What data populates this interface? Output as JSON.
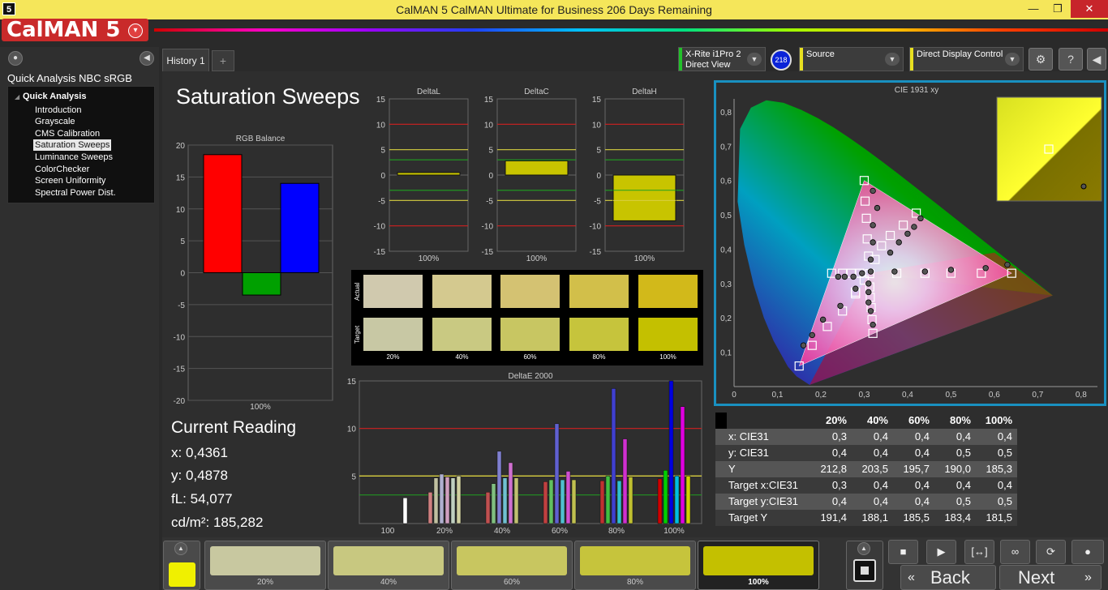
{
  "window": {
    "title": "CalMAN 5 CalMAN Ultimate for Business 206 Days Remaining",
    "app_icon": "5",
    "minimize": "—",
    "restore": "❐",
    "close": "✕"
  },
  "logo": {
    "text": "CalMAN 5"
  },
  "sidebar": {
    "workflow_title": "Quick Analysis NBC sRGB",
    "root": "Quick Analysis",
    "items": [
      {
        "label": "Introduction"
      },
      {
        "label": "Grayscale"
      },
      {
        "label": "CMS Calibration"
      },
      {
        "label": "Saturation Sweeps",
        "selected": true
      },
      {
        "label": "Luminance Sweeps"
      },
      {
        "label": "ColorChecker"
      },
      {
        "label": "Screen Uniformity"
      },
      {
        "label": "Spectral Power Dist."
      }
    ]
  },
  "tabs": {
    "history": "History 1",
    "add": "+"
  },
  "devices": {
    "meter": {
      "line1": "X-Rite i1Pro 2",
      "line2": "Direct View",
      "badge": "218",
      "color": "#22c02a"
    },
    "source": {
      "label": "Source",
      "color": "#e8e020"
    },
    "display": {
      "label": "Direct Display Control",
      "color": "#e8e020"
    }
  },
  "page": {
    "title": "Saturation Sweeps"
  },
  "rgb_balance": {
    "title": "RGB Balance",
    "xlabel": "100%"
  },
  "delta_l": {
    "title": "DeltaL",
    "xlabel": "100%"
  },
  "delta_c": {
    "title": "DeltaC",
    "xlabel": "100%"
  },
  "delta_h": {
    "title": "DeltaH",
    "xlabel": "100%"
  },
  "swatches": {
    "actual_label": "Actual",
    "target_label": "Target",
    "labels": [
      "20%",
      "40%",
      "60%",
      "80%",
      "100%"
    ],
    "actual": [
      "#d0c9ae",
      "#d4c98f",
      "#d4c272",
      "#d2bf4a",
      "#d2b91a"
    ],
    "target": [
      "#c8c8a4",
      "#c9c982",
      "#c8c662",
      "#c6c43c",
      "#c4c000"
    ]
  },
  "deltae": {
    "title": "DeltaE 2000"
  },
  "current_reading": {
    "title": "Current Reading",
    "x": "x: 0,4361",
    "y": "y: 0,4878",
    "fl": "fL: 54,077",
    "cdm2": "cd/m²: 185,282"
  },
  "cie": {
    "title": "CIE 1931 xy"
  },
  "table": {
    "headers": [
      "20%",
      "40%",
      "60%",
      "80%",
      "100%"
    ],
    "rows": [
      {
        "label": "x: CIE31",
        "values": [
          "0,3",
          "0,4",
          "0,4",
          "0,4",
          "0,4"
        ]
      },
      {
        "label": "y: CIE31",
        "values": [
          "0,4",
          "0,4",
          "0,4",
          "0,5",
          "0,5"
        ]
      },
      {
        "label": "Y",
        "values": [
          "212,8",
          "203,5",
          "195,7",
          "190,0",
          "185,3"
        ]
      },
      {
        "label": "Target x:CIE31",
        "values": [
          "0,3",
          "0,4",
          "0,4",
          "0,4",
          "0,4"
        ]
      },
      {
        "label": "Target y:CIE31",
        "values": [
          "0,4",
          "0,4",
          "0,4",
          "0,5",
          "0,5"
        ]
      },
      {
        "label": "Target Y",
        "values": [
          "191,4",
          "188,1",
          "185,5",
          "183,4",
          "181,5"
        ]
      }
    ]
  },
  "pages": [
    {
      "label": "",
      "color": "#f0f000"
    },
    {
      "label": "20%",
      "color": "#c8c8a0"
    },
    {
      "label": "40%",
      "color": "#c8c880"
    },
    {
      "label": "60%",
      "color": "#c8c660"
    },
    {
      "label": "80%",
      "color": "#c6c43c"
    },
    {
      "label": "100%",
      "color": "#c4c000"
    }
  ],
  "nav": {
    "back": "Back",
    "next": "Next"
  },
  "chart_data": [
    {
      "type": "bar",
      "title": "RGB Balance",
      "categories": [
        "100%"
      ],
      "series": [],
      "values": [
        18.5,
        -3.5,
        14.0
      ],
      "colors": [
        "#ff0000",
        "#00a000",
        "#0000ff"
      ],
      "ylim": [
        -20,
        20
      ],
      "yticks": [
        -20,
        -15,
        -10,
        -5,
        0,
        5,
        10,
        15,
        20
      ]
    },
    {
      "type": "bar",
      "title": "DeltaL",
      "categories": [
        "100%"
      ],
      "values": [
        0.5
      ],
      "ylim": [
        -15,
        15
      ],
      "yticks": [
        -15,
        -10,
        -5,
        0,
        5,
        10,
        15
      ]
    },
    {
      "type": "bar",
      "title": "DeltaC",
      "categories": [
        "100%"
      ],
      "values": [
        2.8
      ],
      "ylim": [
        -15,
        15
      ],
      "yticks": [
        -15,
        -10,
        -5,
        0,
        5,
        10,
        15
      ]
    },
    {
      "type": "bar",
      "title": "DeltaH",
      "categories": [
        "100%"
      ],
      "values": [
        -9.0
      ],
      "ylim": [
        -15,
        15
      ],
      "yticks": [
        -15,
        -10,
        -5,
        0,
        5,
        10,
        15
      ]
    },
    {
      "type": "bar",
      "title": "DeltaE 2000",
      "categories": [
        "100",
        "20%",
        "40%",
        "60%",
        "80%",
        "100%"
      ],
      "ylim": [
        0,
        15
      ],
      "yticks": [
        5,
        10,
        15
      ],
      "groups": [
        [
          {
            "v": 2.7,
            "c": "#ffffff"
          }
        ],
        [
          {
            "v": 3.3,
            "c": "#d08080"
          },
          {
            "v": 4.8,
            "c": "#c0c0a0"
          },
          {
            "v": 5.2,
            "c": "#b0b0d0"
          },
          {
            "v": 4.9,
            "c": "#d0a0c0"
          },
          {
            "v": 4.8,
            "c": "#c0d0c0"
          },
          {
            "v": 5.0,
            "c": "#d0d0a0"
          }
        ],
        [
          {
            "v": 3.3,
            "c": "#c05050"
          },
          {
            "v": 4.2,
            "c": "#80c080"
          },
          {
            "v": 7.6,
            "c": "#8080d0"
          },
          {
            "v": 4.8,
            "c": "#70c0d0"
          },
          {
            "v": 6.4,
            "c": "#d070d0"
          },
          {
            "v": 4.8,
            "c": "#c0c070"
          }
        ],
        [
          {
            "v": 4.4,
            "c": "#c04040"
          },
          {
            "v": 4.6,
            "c": "#60c060"
          },
          {
            "v": 10.5,
            "c": "#6060d0"
          },
          {
            "v": 4.6,
            "c": "#50c0d0"
          },
          {
            "v": 5.5,
            "c": "#d050d0"
          },
          {
            "v": 4.6,
            "c": "#c0c050"
          }
        ],
        [
          {
            "v": 4.5,
            "c": "#c03030"
          },
          {
            "v": 5.0,
            "c": "#40c040"
          },
          {
            "v": 14.2,
            "c": "#4040d0"
          },
          {
            "v": 4.5,
            "c": "#30c0d0"
          },
          {
            "v": 8.9,
            "c": "#d030d0"
          },
          {
            "v": 4.9,
            "c": "#c0c030"
          }
        ],
        [
          {
            "v": 4.7,
            "c": "#d00000"
          },
          {
            "v": 5.6,
            "c": "#00d000"
          },
          {
            "v": 15.0,
            "c": "#0000e0"
          },
          {
            "v": 5.0,
            "c": "#00c0e0"
          },
          {
            "v": 12.3,
            "c": "#e000e0"
          },
          {
            "v": 5.0,
            "c": "#d0d000"
          }
        ]
      ]
    },
    {
      "type": "scatter",
      "title": "CIE 1931 xy",
      "xlim": [
        0,
        0.8
      ],
      "ylim": [
        0,
        0.8
      ],
      "xticks": [
        "0",
        "0,1",
        "0,2",
        "0,3",
        "0,4",
        "0,5",
        "0,6",
        "0,7",
        "0,8"
      ],
      "yticks": [
        "0,1",
        "0,2",
        "0,3",
        "0,4",
        "0,5",
        "0,6",
        "0,7",
        "0,8"
      ],
      "targets": [
        [
          0.3127,
          0.329
        ],
        [
          0.64,
          0.33
        ],
        [
          0.57,
          0.33
        ],
        [
          0.5,
          0.33
        ],
        [
          0.44,
          0.33
        ],
        [
          0.375,
          0.33
        ],
        [
          0.3,
          0.6
        ],
        [
          0.302,
          0.54
        ],
        [
          0.305,
          0.49
        ],
        [
          0.307,
          0.43
        ],
        [
          0.31,
          0.38
        ],
        [
          0.15,
          0.06
        ],
        [
          0.18,
          0.12
        ],
        [
          0.215,
          0.175
        ],
        [
          0.25,
          0.22
        ],
        [
          0.28,
          0.27
        ],
        [
          0.225,
          0.33
        ],
        [
          0.25,
          0.33
        ],
        [
          0.27,
          0.33
        ],
        [
          0.29,
          0.33
        ],
        [
          0.32,
          0.155
        ],
        [
          0.318,
          0.195
        ],
        [
          0.316,
          0.23
        ],
        [
          0.314,
          0.26
        ],
        [
          0.313,
          0.29
        ],
        [
          0.42,
          0.505
        ],
        [
          0.39,
          0.47
        ],
        [
          0.36,
          0.44
        ],
        [
          0.34,
          0.41
        ],
        [
          0.325,
          0.37
        ],
        [
          0.28,
          0.275
        ],
        [
          0.3,
          0.31
        ]
      ],
      "measured": [
        [
          0.63,
          0.355
        ],
        [
          0.58,
          0.345
        ],
        [
          0.5,
          0.34
        ],
        [
          0.44,
          0.335
        ],
        [
          0.37,
          0.335
        ],
        [
          0.315,
          0.335
        ],
        [
          0.32,
          0.57
        ],
        [
          0.33,
          0.52
        ],
        [
          0.32,
          0.47
        ],
        [
          0.32,
          0.42
        ],
        [
          0.315,
          0.37
        ],
        [
          0.16,
          0.12
        ],
        [
          0.18,
          0.15
        ],
        [
          0.205,
          0.195
        ],
        [
          0.245,
          0.235
        ],
        [
          0.28,
          0.285
        ],
        [
          0.24,
          0.32
        ],
        [
          0.255,
          0.32
        ],
        [
          0.275,
          0.32
        ],
        [
          0.295,
          0.33
        ],
        [
          0.32,
          0.18
        ],
        [
          0.315,
          0.22
        ],
        [
          0.31,
          0.245
        ],
        [
          0.31,
          0.275
        ],
        [
          0.31,
          0.3
        ],
        [
          0.43,
          0.49
        ],
        [
          0.415,
          0.465
        ],
        [
          0.4,
          0.445
        ],
        [
          0.38,
          0.42
        ],
        [
          0.36,
          0.39
        ]
      ],
      "inset_point": [
        0.35,
        0.25
      ]
    }
  ]
}
